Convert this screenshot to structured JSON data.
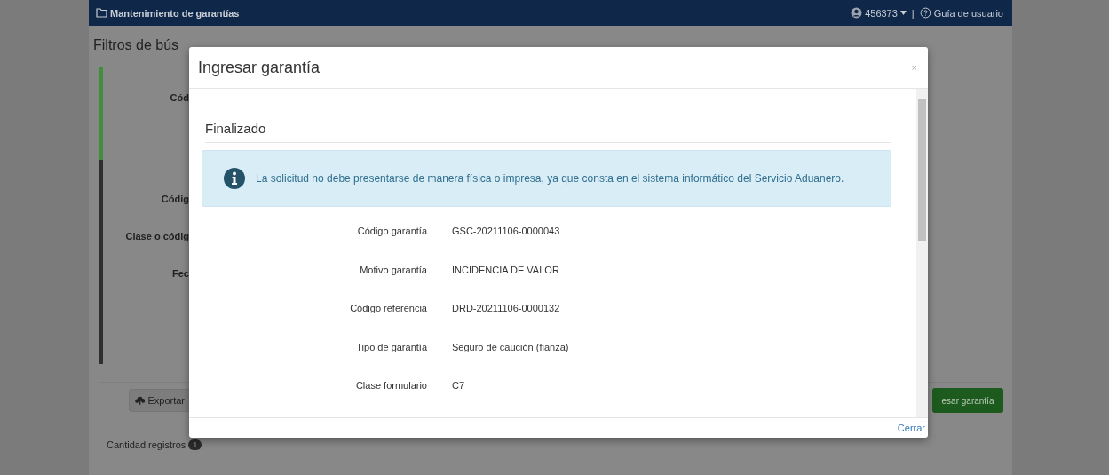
{
  "header": {
    "title": "Mantenimiento de garantías",
    "user": "456373",
    "separator": "|",
    "help": "Guía de usuario"
  },
  "page": {
    "title": "Filtros de bús",
    "groups": [
      {
        "color": "#3f8f3f",
        "labels": [
          "Cód"
        ]
      },
      {
        "color": "#2f2f2f",
        "labels": [
          "Códig",
          "Clase o códig",
          "Fec"
        ]
      }
    ],
    "export_button": "Exportar",
    "add_button": "esar garantía",
    "count_label": "Cantidad registros",
    "count": "1"
  },
  "modal": {
    "title": "Ingresar garantía",
    "close": "×",
    "section": "Finalizado",
    "alert": "La solicitud no debe presentarse de manera física o impresa, ya que consta en el sistema informático del Servicio Aduanero.",
    "fields": [
      {
        "label": "Código garantía",
        "value": "GSC-20211106-0000043"
      },
      {
        "label": "Motivo garantía",
        "value": "INCIDENCIA DE VALOR"
      },
      {
        "label": "Código referencia",
        "value": "DRD-20211106-0000132"
      },
      {
        "label": "Tipo de garantía",
        "value": "Seguro de caución (fianza)"
      },
      {
        "label": "Clase formulario",
        "value": "C7"
      }
    ],
    "footer_link": "Cerrar"
  }
}
